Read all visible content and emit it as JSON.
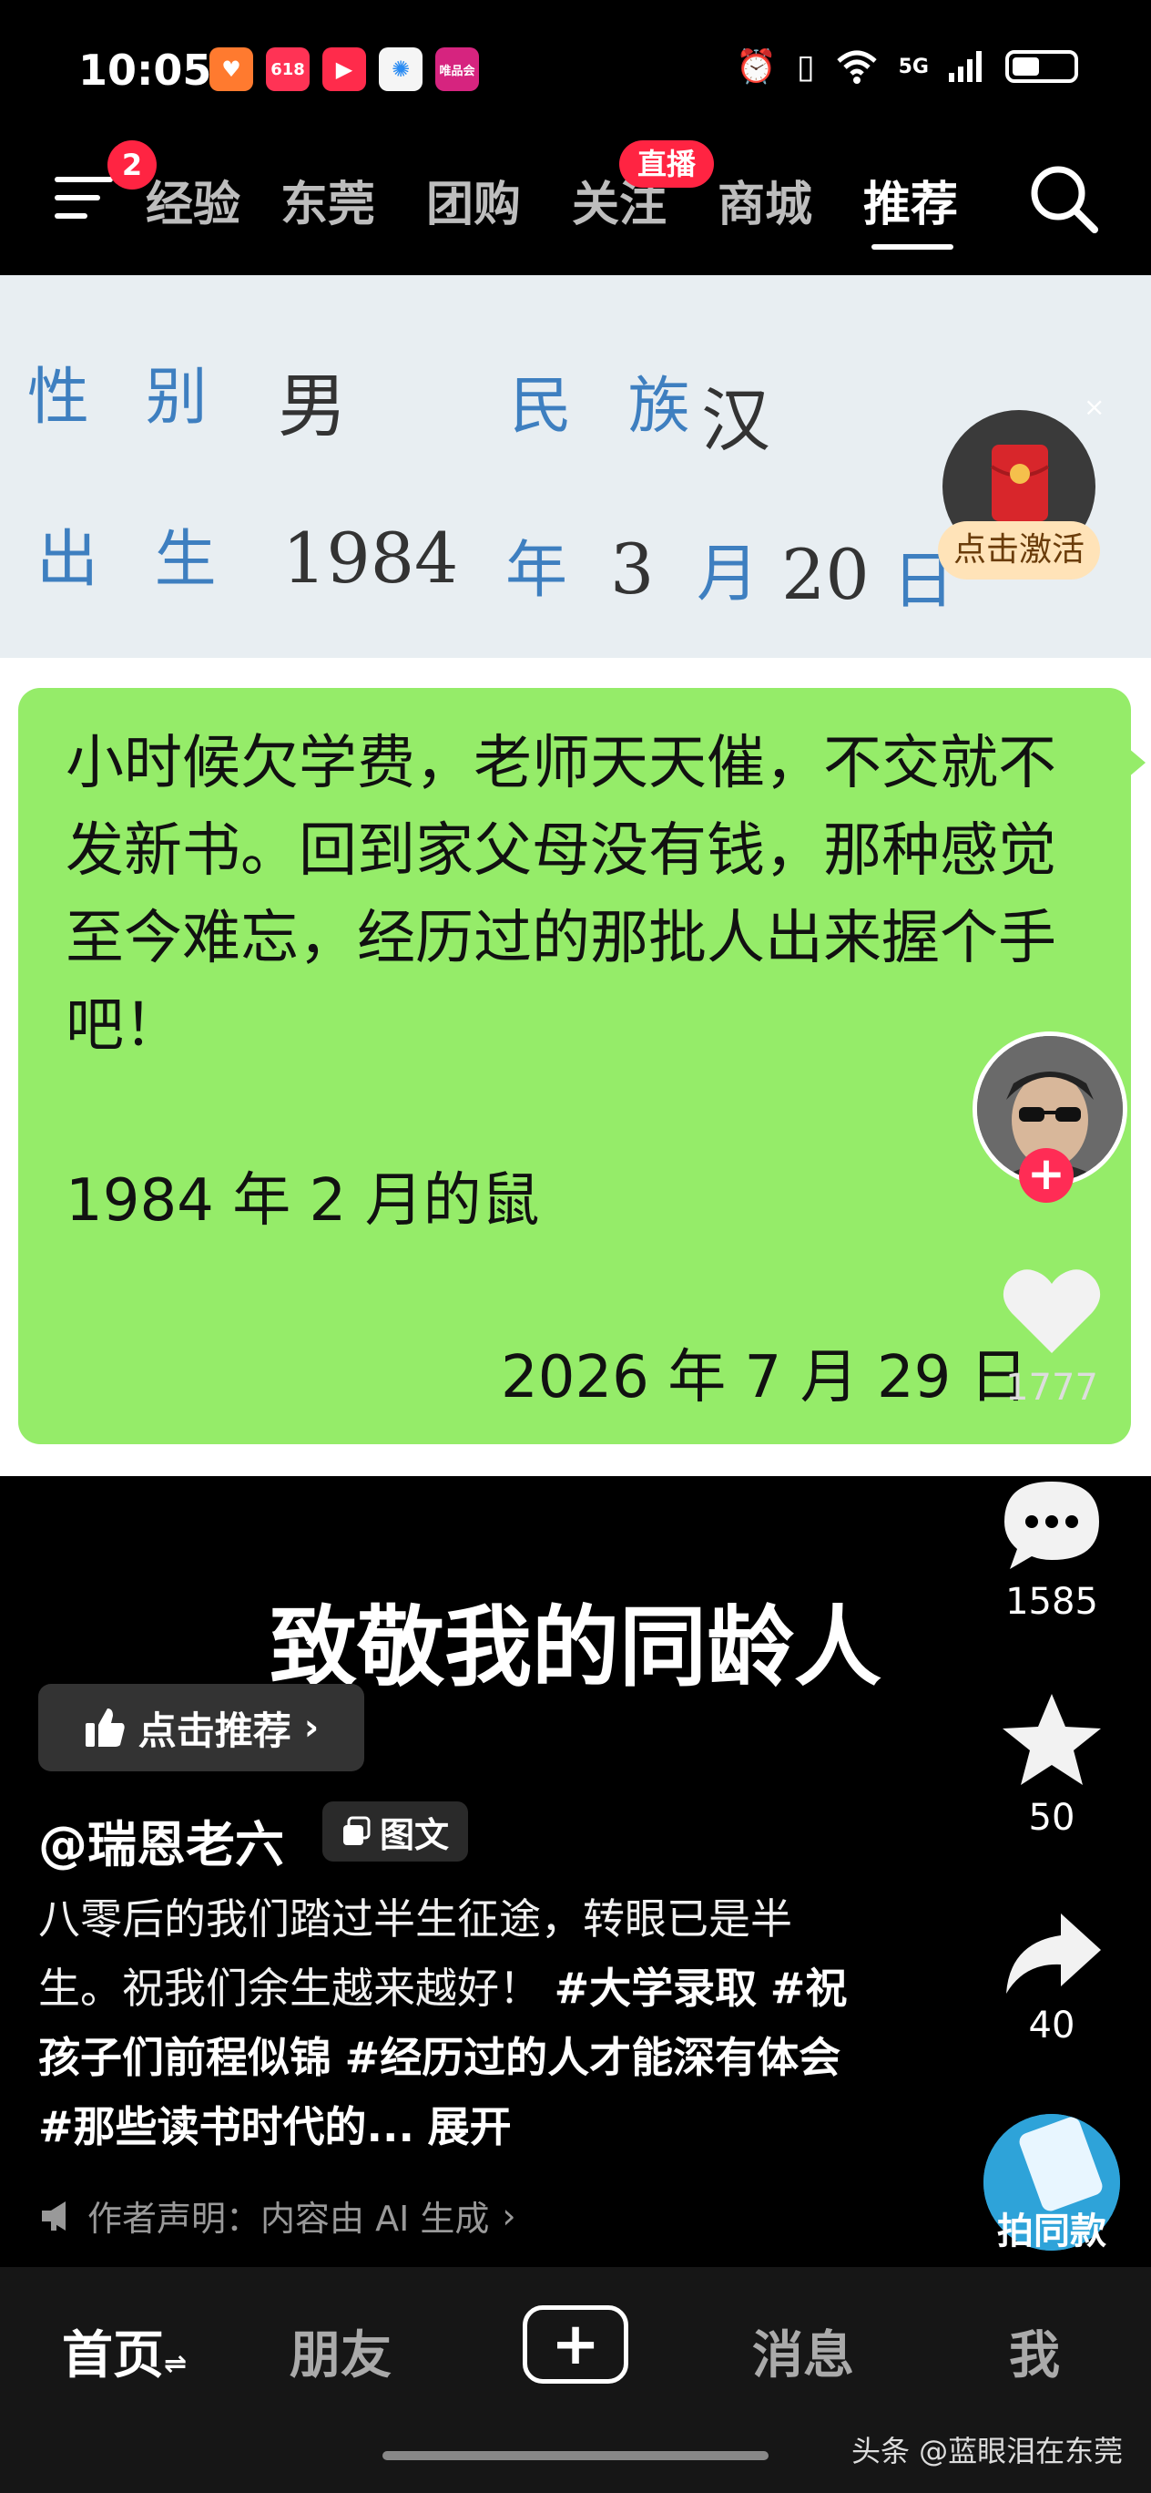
{
  "status_bar": {
    "time": "10:05",
    "network": "5G",
    "app_icons": [
      {
        "name": "heart-app-icon",
        "color": "#ff7a2f",
        "glyph": "♥"
      },
      {
        "name": "shopping-618-icon",
        "color": "#ff3355",
        "glyph": "618"
      },
      {
        "name": "video-app-icon",
        "color": "#ff2b4b",
        "glyph": "▶"
      },
      {
        "name": "pinwheel-app-icon",
        "color": "#f5f5f5",
        "glyph": "✺"
      },
      {
        "name": "vip-app-icon",
        "color": "#d6247f",
        "glyph": "唯品会"
      }
    ]
  },
  "nav": {
    "menu_badge": "2",
    "tabs": [
      {
        "label": "经验"
      },
      {
        "label": "东莞"
      },
      {
        "label": "团购"
      },
      {
        "label": "关注",
        "badge": "直播"
      },
      {
        "label": "商城"
      },
      {
        "label": "推荐",
        "active": true
      }
    ]
  },
  "id_card": {
    "gender_label": "性 别",
    "gender_value": "男",
    "ethnicity_label": "民 族",
    "ethnicity_value": "汉",
    "birth_label": "出 生",
    "birth_year": "1984",
    "year_char": "年",
    "birth_month": "3",
    "month_char": "月",
    "birth_day": "20",
    "day_char": "日"
  },
  "red_packet": {
    "label": "点击激活",
    "close": "×"
  },
  "note": {
    "text": "小时候欠学费，老师天天催，不交就不发新书。回到家父母没有钱，那种感觉至今难忘，经历过的那批人出来握个手吧！",
    "sub": "1984 年 2 月的鼠",
    "date": "2026 年 7 月 29 日"
  },
  "rail": {
    "likes": "1777",
    "comments": "1585",
    "favorites": "50",
    "shares": "40",
    "follow": "+"
  },
  "post": {
    "title": "致敬我的同龄人",
    "recommend_label": "点击推荐",
    "author": "@瑞恩老六",
    "type_tag": "图文",
    "desc_plain": "八零后的我们踏过半生征途，转眼已是半生。祝我们余生越来越好！",
    "tags": [
      "#大学录取",
      "#祝孩子们前程似锦",
      "#经历过的人才能深有体会",
      "#那些读书时代的..."
    ],
    "expand": "展开",
    "disclaimer": "作者声明：内容由 AI 生成",
    "same_style_label": "拍同款"
  },
  "bottom_nav": {
    "home": "首页",
    "friends": "朋友",
    "add": "+",
    "messages": "消息",
    "me": "我"
  },
  "watermark": "头条 @蓝眼泪在东莞",
  "colors": {
    "bubble_green": "#95ec69",
    "badge_red": "#ff2442",
    "id_blue": "#3e7fc0"
  }
}
